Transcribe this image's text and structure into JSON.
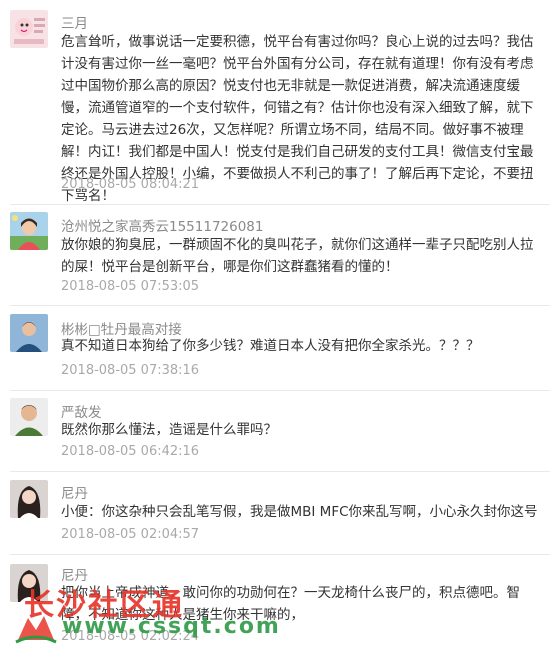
{
  "comments": [
    {
      "name": "三月",
      "text": "危言耸听，做事说话一定要积德，悦平台有害过你吗？良心上说的过去吗？我估计没有害过你一丝一毫吧？悦平台外国有分公司，存在就有道理！你有没有考虑过中国物价那么高的原因？悦支付也无非就是一款促进消费，解决流通速度缓慢，流通管道窄的一个支付软件，何错之有？估计你也没有深入细致了解，就下定论。马云进去过26次，又怎样呢？所谓立场不同，结局不同。做好事不被理解！内讧！我们都是中国人！悦支付是我们自己研发的支付工具！微信支付宝最终还是外国人控股！小编，不要做损人不利己的事了！了解后再下定论，不要扭下骂名！",
      "time": "2018-08-05 08:04:21",
      "avatar": "pink-cartoon-avatar"
    },
    {
      "name": "沧州悦之家高秀云15511726081",
      "text": "放你娘的狗臭屁，一群顽固不化的臭叫花子，就你们这通样一辈子只配吃别人拉的屎！悦平台是创新平台，哪是你们这群蠢猪看的懂的！",
      "time": "2018-08-05 07:53:05",
      "avatar": "woman-outdoor-avatar"
    },
    {
      "name": "彬彬□牡丹最高对接",
      "text": "真不知道日本狗给了你多少钱？难道日本人没有把你全家杀光。？？？",
      "time": "2018-08-05 07:38:16",
      "avatar": "man-blue-avatar"
    },
    {
      "name": "严敌发",
      "text": "既然你那么懂法，造谣是什么罪吗？",
      "time": "2018-08-05 06:42:16",
      "avatar": "man-portrait-avatar"
    },
    {
      "name": "尼丹",
      "text": "小便：你这杂种只会乱笔写假，我是做MBI MFC你来乱写啊，小心永久封你这号",
      "time": "2018-08-05 02:04:57",
      "avatar": "woman-portrait-avatar"
    },
    {
      "name": "尼丹",
      "text": "把你当上帝成神道，敢问你的功勋何在？一天龙椅什么丧尸的，积点德吧。智障，不知道你这种人是猪生你来干嘛的，",
      "time": "2018-08-05 02:02:24",
      "avatar": "woman-portrait-avatar"
    }
  ],
  "watermark": {
    "text": "长沙社区通",
    "url": "www.cssqt.com",
    "colors": {
      "text": "#e8362b",
      "url": "#2e9a46"
    }
  }
}
